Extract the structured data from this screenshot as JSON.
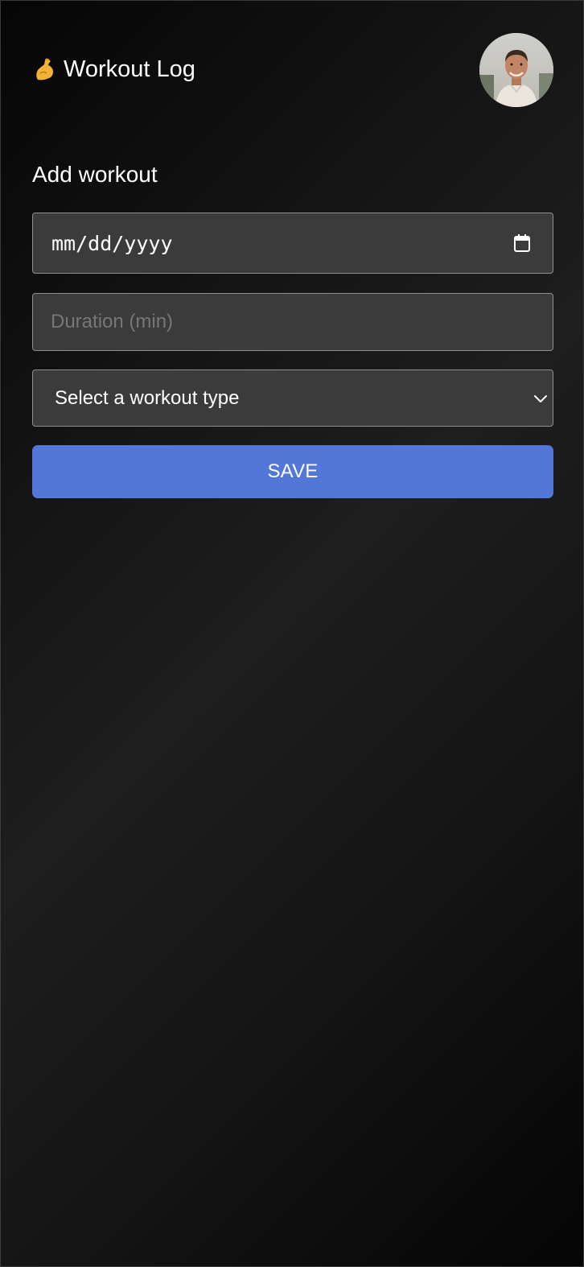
{
  "header": {
    "title": "Workout Log",
    "title_icon": "flexed-biceps-icon",
    "avatar_icon": "user-avatar"
  },
  "form": {
    "heading": "Add workout",
    "date_placeholder": "mm/dd/yyyy",
    "date_icon": "calendar-icon",
    "duration_placeholder": "Duration (min)",
    "duration_value": "",
    "workout_type_selected": "Select a workout type",
    "workout_type_icon": "chevron-down-icon",
    "save_label": "SAVE"
  },
  "colors": {
    "background": "#111111",
    "field_background": "#3b3b3b",
    "field_border": "#8e8e8e",
    "accent": "#5277d9",
    "text": "#ffffff",
    "placeholder": "#777777"
  }
}
